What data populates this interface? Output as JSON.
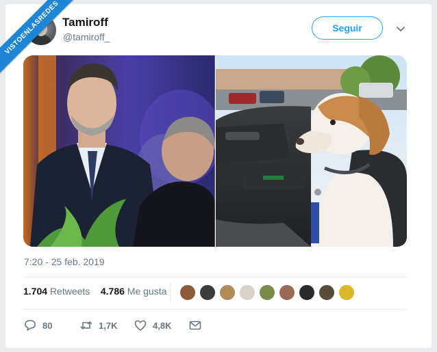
{
  "watermark": "VISTOENLASREDES",
  "tweet": {
    "author_name": "Tamiroff",
    "author_handle": "@tamiroff_",
    "follow_label": "Seguir",
    "timestamp": "7:20 - 25 feb. 2019"
  },
  "stats": {
    "retweets_count": "1.704",
    "retweets_label": "Retweets",
    "likes_count": "4.786",
    "likes_label": "Me gusta"
  },
  "actions": {
    "reply_count": "80",
    "retweet_count": "1,7K",
    "like_count": "4,8K"
  },
  "icons": [
    "chevron-down-icon",
    "reply-icon",
    "retweet-icon",
    "heart-icon",
    "mail-icon"
  ],
  "colors": {
    "accent": "#1da1f2",
    "muted": "#657786",
    "banner": "#1f86d6"
  }
}
